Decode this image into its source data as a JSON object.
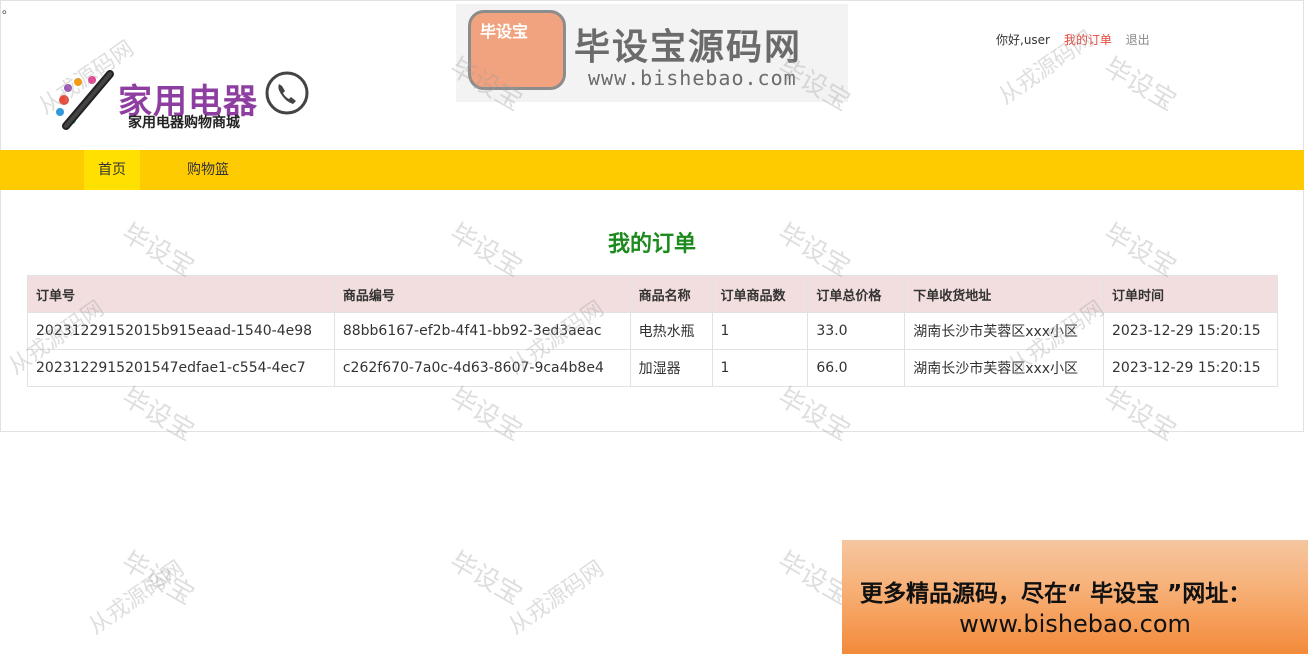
{
  "colors": {
    "nav_bg": "#fecb00",
    "nav_active_bg": "#ffe000",
    "title_green": "#1c8a1c",
    "link_red": "#e8473a",
    "table_header_bg": "#f2dede"
  },
  "top_mark": "。",
  "header": {
    "logo_title": "家用电器",
    "logo_subtitle": "家用电器购物商城",
    "logo_icons": [
      "pencil-icon",
      "phone-icon"
    ],
    "brand_badge": "毕设宝",
    "brand_name": "毕设宝源码网",
    "brand_url": "www.bishebao.com",
    "greeting": "你好,user",
    "my_orders": "我的订单",
    "logout": "退出"
  },
  "nav": {
    "home": "首页",
    "cart": "购物篮",
    "active": "首页"
  },
  "main": {
    "title": "我的订单",
    "columns": [
      "订单号",
      "商品编号",
      "商品名称",
      "订单商品数",
      "订单总价格",
      "下单收货地址",
      "订单时间"
    ],
    "rows": [
      [
        "20231229152015b915eaad-1540-4e98",
        "88bb6167-ef2b-4f41-bb92-3ed3aeac",
        "电热水瓶",
        "1",
        "33.0",
        "湖南长沙市芙蓉区xxx小区",
        "2023-12-29 15:20:15"
      ],
      [
        "2023122915201547edfae1-c554-4ec7",
        "c262f670-7a0c-4d63-8607-9ca4b8e4",
        "加湿器",
        "1",
        "66.0",
        "湖南长沙市芙蓉区xxx小区",
        "2023-12-29 15:20:15"
      ]
    ]
  },
  "watermarks": {
    "short": "毕设宝",
    "long": "从戎源码网"
  },
  "promo": {
    "line1": "更多精品源码，尽在“ 毕设宝 ”网址：",
    "line2": "www.bishebao.com"
  }
}
